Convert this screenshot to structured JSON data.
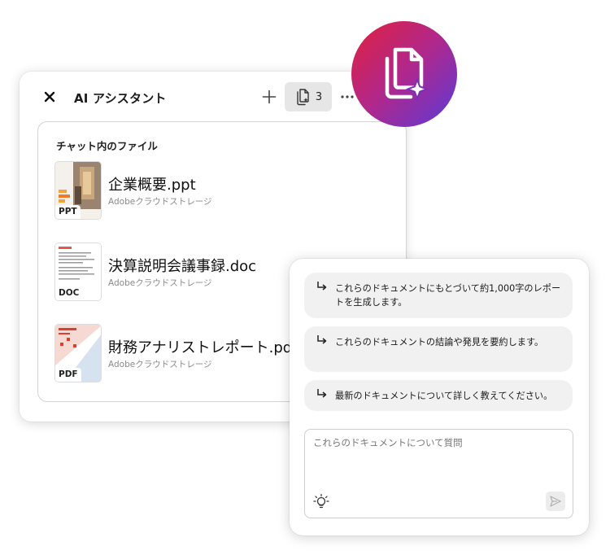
{
  "header": {
    "title": "AI アシスタント",
    "file_count": "3",
    "close_icon": "close-icon",
    "add_icon": "plus-icon",
    "files_icon": "files-icon",
    "more_icon": "more-icon"
  },
  "files_panel": {
    "title": "チャット内のファイル",
    "files": [
      {
        "name": "企業概要.ppt",
        "source": "Adobeクラウドストレージ",
        "type": "PPT"
      },
      {
        "name": "決算説明会議事録.doc",
        "source": "Adobeクラウドストレージ",
        "type": "DOC"
      },
      {
        "name": "財務アナリストレポート.pdf",
        "source": "Adobeクラウドストレージ",
        "type": "PDF"
      }
    ]
  },
  "app_icon": {
    "icon": "ai-documents-icon",
    "gradient": [
      "#e0213d",
      "#b2278a",
      "#5a3ad8"
    ]
  },
  "chat": {
    "suggestions": [
      "これらのドキュメントにもとづいて約1,000字のレポートを生成します。",
      "これらのドキュメントの結論や発見を要約します。",
      "最新のドキュメントについて詳しく教えてください。"
    ],
    "input": {
      "placeholder": "これらのドキュメントについて質問",
      "value": ""
    },
    "bulb_icon": "lightbulb-icon",
    "send_icon": "send-icon"
  },
  "colors": {
    "accent_red": "#e0213d",
    "accent_purple": "#5a3ad8",
    "suggestion_bg": "#f1f1f1",
    "border": "#d4d4d4"
  }
}
